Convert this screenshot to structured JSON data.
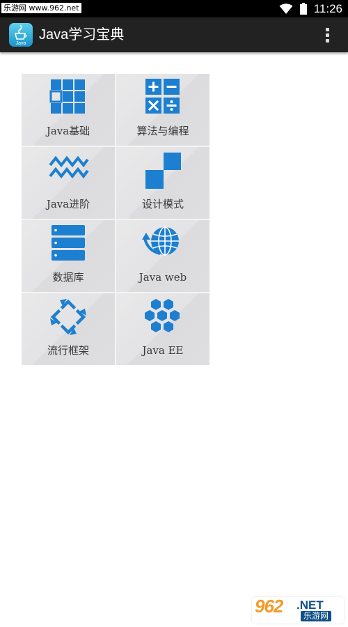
{
  "status_bar": {
    "watermark": "乐游网 www.962.net",
    "time": "11:26",
    "wifi_icon": "wifi-icon",
    "battery_icon": "battery-icon"
  },
  "app_bar": {
    "title": "Java学习宝典",
    "icon_label": "Java",
    "app_icon": "java-cup-icon",
    "menu_icon": "overflow-menu-icon",
    "background": "#222222"
  },
  "accent_color": "#1d7fd0",
  "tiles": [
    {
      "label": "Java基础",
      "icon": "grid-icon"
    },
    {
      "label": "算法与编程",
      "icon": "calculator-icon"
    },
    {
      "label": "Java进阶",
      "icon": "zigzag-icon"
    },
    {
      "label": "设计模式",
      "icon": "squares-pattern-icon"
    },
    {
      "label": "数据库",
      "icon": "database-icon"
    },
    {
      "label": "Java web",
      "icon": "globe-icon"
    },
    {
      "label": "流行框架",
      "icon": "arrows-cycle-icon"
    },
    {
      "label": "Java EE",
      "icon": "hexagons-icon"
    }
  ],
  "bottom_watermark": {
    "number": "962",
    "net": ".NET",
    "site": "乐游网"
  }
}
